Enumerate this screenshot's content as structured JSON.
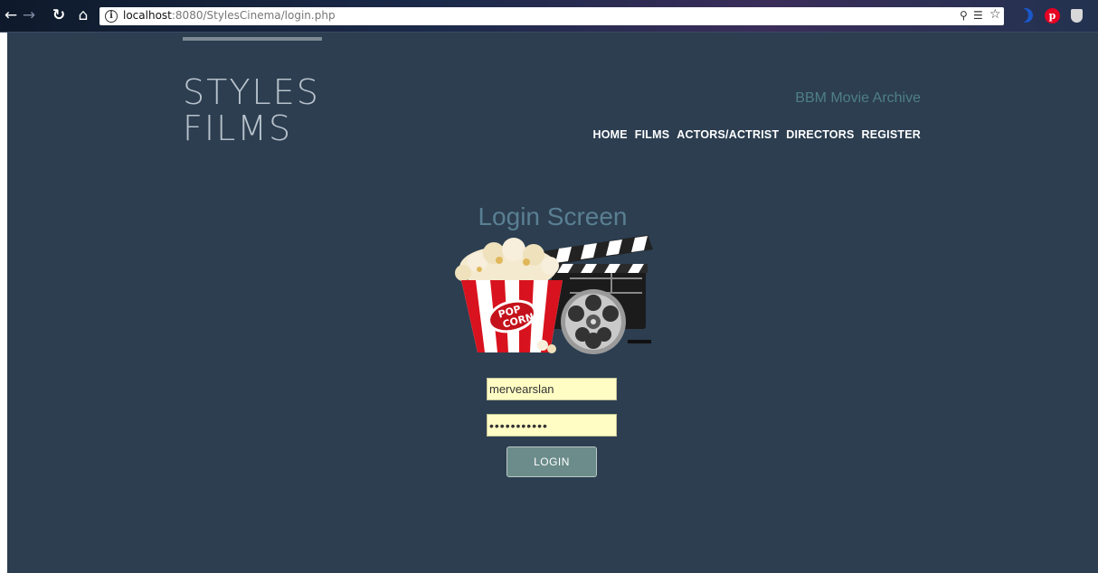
{
  "browser": {
    "url_host": "localhost",
    "url_path": ":8080/StylesCinema/login.php"
  },
  "site": {
    "logo_line1": "STYLES",
    "logo_line2": "FILMS",
    "tagline": "BBM Movie Archive",
    "nav": [
      {
        "label": "HOME"
      },
      {
        "label": "FILMS"
      },
      {
        "label": "ACTORS/ACTRIST"
      },
      {
        "label": "DIRECTORS"
      },
      {
        "label": "REGISTER"
      }
    ]
  },
  "login": {
    "title": "Login Screen",
    "username_value": "mervearslan",
    "password_value": "mervearslan",
    "button_label": "LOGIN"
  },
  "colors": {
    "page_bg": "#2c3e50",
    "tagline": "#4f7f88",
    "title": "#5a7f92",
    "field_bg": "#fffdc4",
    "button_bg": "#6b8c8a"
  }
}
